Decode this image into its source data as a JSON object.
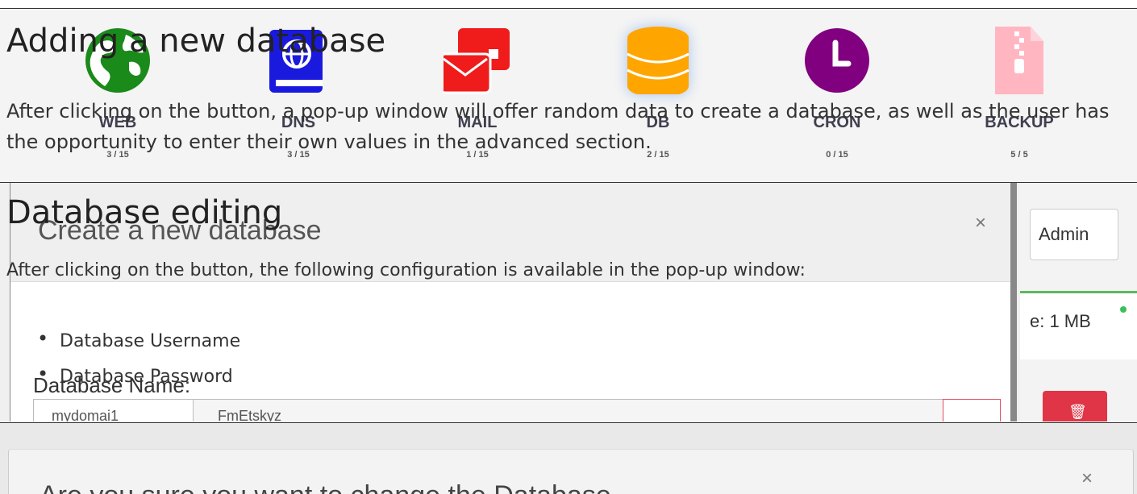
{
  "doc": {
    "adding": {
      "heading": "Adding a new database",
      "text": "After clicking on the button, a pop-up window will offer random data to create a database, as well as the user has the opportunity to enter their own values in the advanced section."
    },
    "editing": {
      "heading": "Database editing",
      "text": "After clicking on the button, the following configuration is available in the pop-up window:",
      "items": [
        "Database Username",
        "Database Password"
      ]
    }
  },
  "services": [
    {
      "label": "WEB",
      "count": "3 / 15",
      "color": "#1a8a1a",
      "icon": "globe-icon"
    },
    {
      "label": "DNS",
      "count": "3 / 15",
      "color": "#1a1adf",
      "icon": "dns-book-icon"
    },
    {
      "label": "MAIL",
      "count": "1 / 15",
      "color": "#f01b1b",
      "icon": "mail-icon"
    },
    {
      "label": "DB",
      "count": "2 / 15",
      "color": "#ffa500",
      "icon": "database-icon"
    },
    {
      "label": "CRON",
      "count": "0 / 15",
      "color": "#800080",
      "icon": "clock-icon"
    },
    {
      "label": "BACKUP",
      "count": "5 / 5",
      "color": "#ffb6c1",
      "icon": "archive-file-icon"
    }
  ],
  "create_modal": {
    "title": "Create a new database",
    "close": "×",
    "db_name_label": "Database Name:",
    "prefix": "mydomai1_",
    "value": "FmEtskyz"
  },
  "side": {
    "admin_label": "Admin",
    "quota_label": "e: 1 MB"
  },
  "change_modal": {
    "title": "Are you sure you want to change the Database",
    "close": "×"
  }
}
